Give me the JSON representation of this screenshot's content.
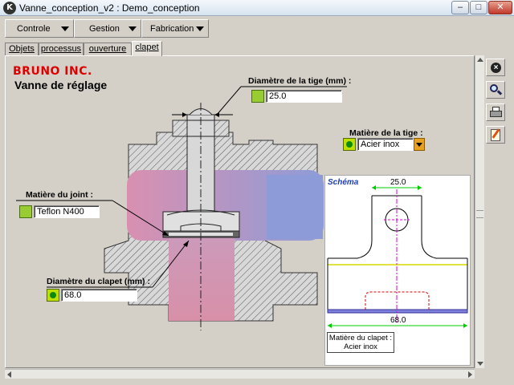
{
  "window": {
    "title": "Vanne_conception_v2 : Demo_conception",
    "app_icon_letter": "K"
  },
  "menus": [
    {
      "label": "Controle"
    },
    {
      "label": "Gestion"
    },
    {
      "label": "Fabrication"
    }
  ],
  "tabs": [
    {
      "label": "Objets"
    },
    {
      "label": "processus"
    },
    {
      "label": "ouverture"
    },
    {
      "label": "clapet",
      "active": true
    }
  ],
  "doc": {
    "brand": "BRUNO INC.",
    "title": "Vanne de réglage"
  },
  "fields": {
    "stem_diameter": {
      "label": "Diamètre de la tige (mm) :",
      "value": "25.0"
    },
    "stem_material": {
      "label": "Matière de la tige :",
      "value": "Acier inox"
    },
    "seal_material": {
      "label": "Matière du joint :",
      "value": "Teflon N400"
    },
    "valve_diameter": {
      "label": "Diamètre du clapet (mm) :",
      "value": "68.0"
    }
  },
  "schema": {
    "title": "Schéma",
    "dim_top": "25.0",
    "dim_bottom": "68.0",
    "note_line1": "Matière du clapet :",
    "note_line2": "Acier inox"
  },
  "toolbar_icons": [
    "close-circle-icon",
    "magnifier-icon",
    "printer-icon",
    "edit-note-icon"
  ],
  "colors": {
    "brand": "#dd0000",
    "schema_title": "#1a3db8",
    "dimension_green": "#00cc00",
    "centerline_magenta": "#dd00dd",
    "flow_pink": "#d68fb0",
    "flow_blue": "#8d9cd8"
  }
}
